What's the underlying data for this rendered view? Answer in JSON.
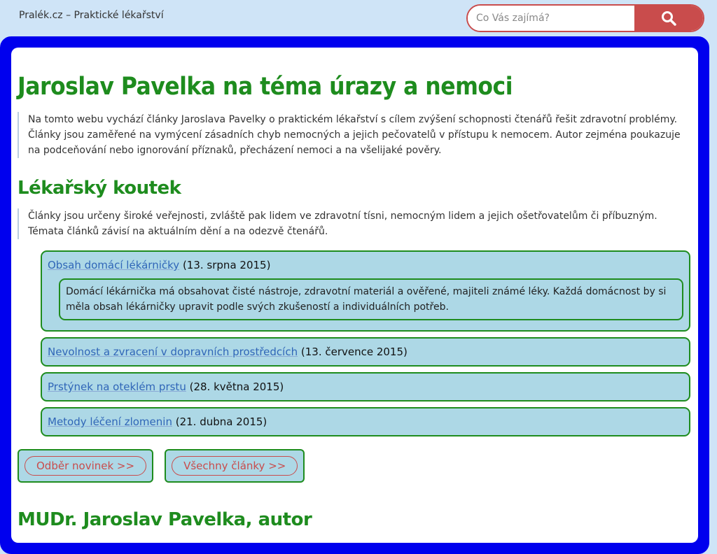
{
  "header": {
    "site_title": "Pralék.cz – Praktické lékařství",
    "search_placeholder": "Co Vás zajímá?"
  },
  "main": {
    "title": "Jaroslav Pavelka na téma úrazy a nemoci",
    "intro": "Na tomto webu vychází články Jaroslava Pavelky o praktickém lékařství s cílem zvýšení schopnosti čtenářů řešit zdravotní problémy. Články jsou zaměřené na vymýcení zásadních chyb nemocných a jejich pečovatelů v přístupu k nemocem. Autor zejména poukazuje na podceňování nebo ignorování příznaků, přecházení nemoci a na všelijaké pověry.",
    "section_title": "Lékařský koutek",
    "section_desc": "Články jsou určeny široké veřejnosti, zvláště pak lidem ve zdravotní tísni, nemocným lidem a jejich ošetřovatelům či příbuzným. Témata článků závisí na aktuálním dění a na odezvě čtenářů.",
    "articles": [
      {
        "title": "Obsah domácí lékárničky",
        "date": "(13. srpna 2015)",
        "excerpt": "Domácí lékárnička má obsahovat čisté nástroje, zdravotní materiál a ověřené, majiteli známé léky. Každá domácnost by si měla obsah lékárničky upravit podle svých zkušeností a individuálních potřeb."
      },
      {
        "title": "Nevolnost a zvracení v dopravních prostředcích",
        "date": "(13. července 2015)"
      },
      {
        "title": "Prstýnek na oteklém prstu",
        "date": "(28. května 2015)"
      },
      {
        "title": "Metody léčení zlomenin",
        "date": "(21. dubna 2015)"
      }
    ],
    "buttons": {
      "subscribe": "Odběr novinek >>",
      "all_articles": "Všechny články >>"
    },
    "author_title": "MUDr. Jaroslav Pavelka, autor"
  },
  "colors": {
    "accent_green": "#1e8c1e",
    "frame_blue": "#0000ee",
    "card_blue": "#add8e6",
    "button_red": "#c94c4c"
  }
}
